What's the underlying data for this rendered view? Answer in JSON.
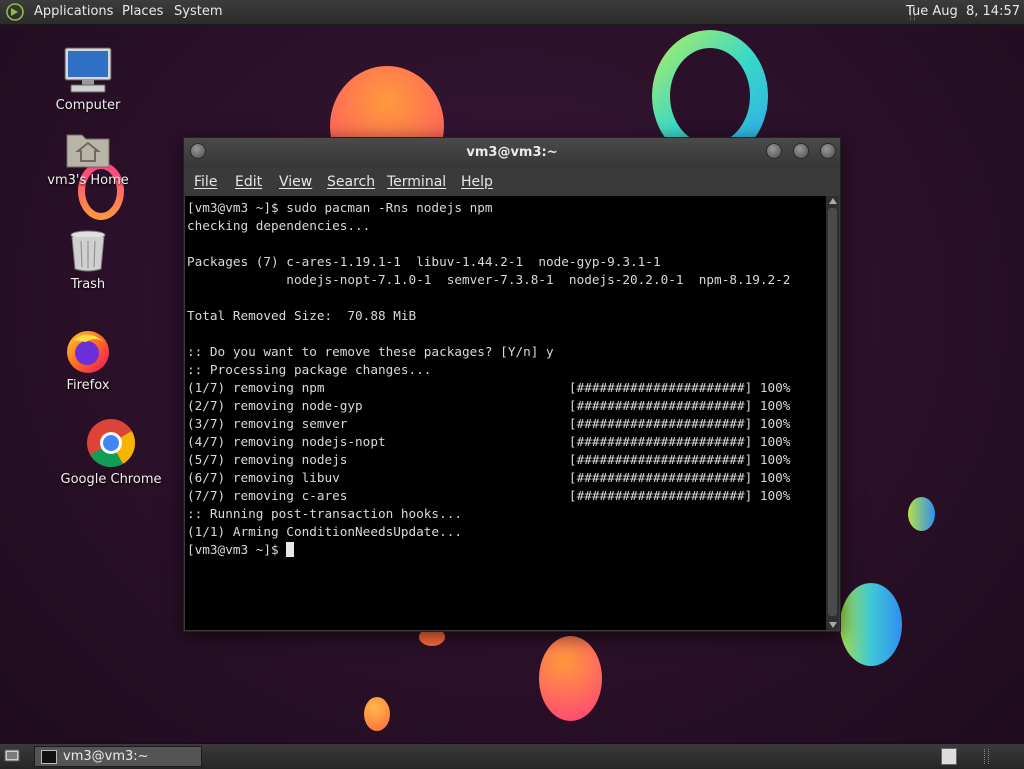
{
  "top_panel": {
    "menus": [
      "Applications",
      "Places",
      "System"
    ],
    "clock": "Tue Aug  8, 14:57"
  },
  "desktop": {
    "icons": [
      {
        "label": "Computer",
        "icon": "computer-icon"
      },
      {
        "label": "vm3's Home",
        "icon": "home-folder-icon"
      },
      {
        "label": "Trash",
        "icon": "trash-icon"
      },
      {
        "label": "Firefox",
        "icon": "firefox-icon"
      },
      {
        "label": "Google Chrome",
        "icon": "chrome-icon"
      }
    ]
  },
  "terminal": {
    "title": "vm3@vm3:~",
    "menu": [
      "File",
      "Edit",
      "View",
      "Search",
      "Terminal",
      "Help"
    ],
    "lines": [
      "[vm3@vm3 ~]$ sudo pacman -Rns nodejs npm",
      "checking dependencies...",
      "",
      "Packages (7) c-ares-1.19.1-1  libuv-1.44.2-1  node-gyp-9.3.1-1",
      "             nodejs-nopt-7.1.0-1  semver-7.3.8-1  nodejs-20.2.0-1  npm-8.19.2-2",
      "",
      "Total Removed Size:  70.88 MiB",
      "",
      ":: Do you want to remove these packages? [Y/n] y",
      ":: Processing package changes...",
      "(1/7) removing npm                                [######################] 100%",
      "(2/7) removing node-gyp                           [######################] 100%",
      "(3/7) removing semver                             [######################] 100%",
      "(4/7) removing nodejs-nopt                        [######################] 100%",
      "(5/7) removing nodejs                             [######################] 100%",
      "(6/7) removing libuv                              [######################] 100%",
      "(7/7) removing c-ares                             [######################] 100%",
      ":: Running post-transaction hooks...",
      "(1/1) Arming ConditionNeedsUpdate..."
    ],
    "prompt": "[vm3@vm3 ~]$ "
  },
  "bottom_panel": {
    "task_label": "vm3@vm3:~"
  },
  "colors": {
    "terminal_bg": "#000000",
    "terminal_fg": "#d9d9d9",
    "desktop_bg": "#2a1028"
  }
}
